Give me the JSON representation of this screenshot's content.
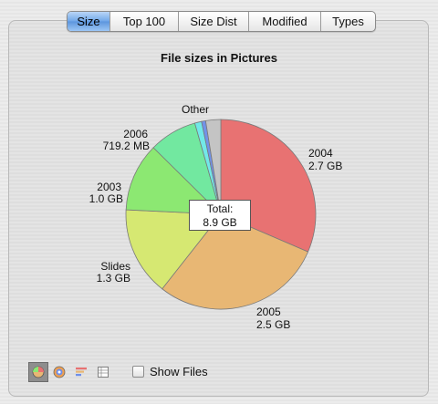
{
  "tabs": [
    {
      "label": "Size",
      "selected": true
    },
    {
      "label": "Top 100",
      "selected": false
    },
    {
      "label": "Size Dist",
      "selected": false
    },
    {
      "label": "Modified",
      "selected": false
    },
    {
      "label": "Types",
      "selected": false
    }
  ],
  "chart_title": "File sizes in Pictures",
  "total": {
    "label": "Total:",
    "value": "8.9 GB"
  },
  "view_buttons": [
    {
      "name": "pie-view-icon",
      "selected": true
    },
    {
      "name": "ring-view-icon",
      "selected": false
    },
    {
      "name": "bar-view-icon",
      "selected": false
    },
    {
      "name": "list-view-icon",
      "selected": false
    }
  ],
  "show_files": {
    "label": "Show Files",
    "checked": false
  },
  "chart_data": {
    "type": "pie",
    "title": "File sizes in Pictures",
    "slices": [
      {
        "name": "2004",
        "label": "2.7 GB",
        "value": 2.7,
        "color": "#e87272"
      },
      {
        "name": "2005",
        "label": "2.5 GB",
        "value": 2.5,
        "color": "#e8b774"
      },
      {
        "name": "Slides",
        "label": "1.3 GB",
        "value": 1.3,
        "color": "#d6e872"
      },
      {
        "name": "2003",
        "label": "1.0 GB",
        "value": 1.0,
        "color": "#8ce872"
      },
      {
        "name": "2006",
        "label": "719.2 MB",
        "value": 0.7,
        "color": "#72e8a0"
      },
      {
        "name": "",
        "label": "",
        "value": 0.1,
        "color": "#72e8e8"
      },
      {
        "name": "",
        "label": "",
        "value": 0.06,
        "color": "#7292e8"
      },
      {
        "name": "Other",
        "label": "",
        "value": 0.22,
        "color": "#c4c4c4"
      }
    ]
  }
}
